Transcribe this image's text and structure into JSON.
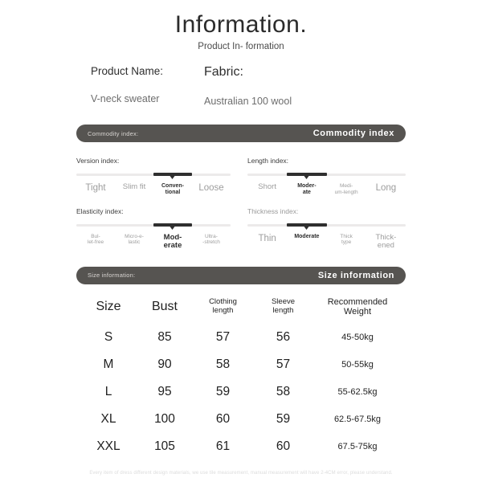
{
  "header": {
    "title": "Information.",
    "subtitle": "Product In-\nformation"
  },
  "product": {
    "name_label": "Product Name:",
    "name_value": "V-neck sweater",
    "fabric_label": "Fabric:",
    "fabric_value": "Australian 100 wool"
  },
  "commodity_banner": {
    "left": "Commodity index:",
    "right": "Commodity index"
  },
  "indices": [
    {
      "title": "Version index:",
      "title_style": "dark",
      "active": 2,
      "options": [
        {
          "label": "Tight",
          "size": "lg"
        },
        {
          "label": "Slim fit",
          "size": "md"
        },
        {
          "label": "Conven-\ntional",
          "size": "sm"
        },
        {
          "label": "Loose",
          "size": "lg"
        }
      ]
    },
    {
      "title": "Length index:",
      "title_style": "dark",
      "active": 1,
      "options": [
        {
          "label": "Short",
          "size": "md"
        },
        {
          "label": "Moder-\nate",
          "size": "sm"
        },
        {
          "label": "Medi-\num-length",
          "size": "xs"
        },
        {
          "label": "Long",
          "size": "lg"
        }
      ]
    },
    {
      "title": "Elasticity index:",
      "title_style": "dark",
      "active": 2,
      "options": [
        {
          "label": "Bul-\nlet-free",
          "size": "xs"
        },
        {
          "label": "Micro-e-\nlastic",
          "size": "xs"
        },
        {
          "label": "Mod-\nerate",
          "size": "md"
        },
        {
          "label": "Ultra-\n-stretch",
          "size": "xs"
        }
      ]
    },
    {
      "title": "Thickness index:",
      "title_style": "light",
      "active": 1,
      "options": [
        {
          "label": "Thin",
          "size": "lg"
        },
        {
          "label": "Moderate",
          "size": "sm"
        },
        {
          "label": "Thick\ntype",
          "size": "xs"
        },
        {
          "label": "Thick-\nened",
          "size": "md"
        }
      ]
    }
  ],
  "size_banner": {
    "left": "Size information:",
    "right": "Size information"
  },
  "size_table": {
    "headers": [
      {
        "label": "Size",
        "size": "lg"
      },
      {
        "label": "Bust",
        "size": "lg"
      },
      {
        "label": "Clothing\nlength",
        "size": "sm"
      },
      {
        "label": "Sleeve\nlength",
        "size": "sm"
      },
      {
        "label": "Recommended\nWeight",
        "size": "md"
      }
    ],
    "rows": [
      {
        "size": "S",
        "bust": "85",
        "clothing_length": "57",
        "sleeve_length": "56",
        "weight": "45-50kg"
      },
      {
        "size": "M",
        "bust": "90",
        "clothing_length": "58",
        "sleeve_length": "57",
        "weight": "50-55kg"
      },
      {
        "size": "L",
        "bust": "95",
        "clothing_length": "59",
        "sleeve_length": "58",
        "weight": "55-62.5kg"
      },
      {
        "size": "XL",
        "bust": "100",
        "clothing_length": "60",
        "sleeve_length": "59",
        "weight": "62.5-67.5kg"
      },
      {
        "size": "XXL",
        "bust": "105",
        "clothing_length": "61",
        "sleeve_length": "60",
        "weight": "67.5-75kg"
      }
    ]
  },
  "footer": {
    "disclaimer": "Every item of dress different design materials, we use tile measurement, manual measurement will have 2-4CM error, please understand."
  },
  "colors": {
    "banner_bg": "#565451",
    "active_track": "#2f2f2f",
    "inactive_track": "#eceaea"
  }
}
